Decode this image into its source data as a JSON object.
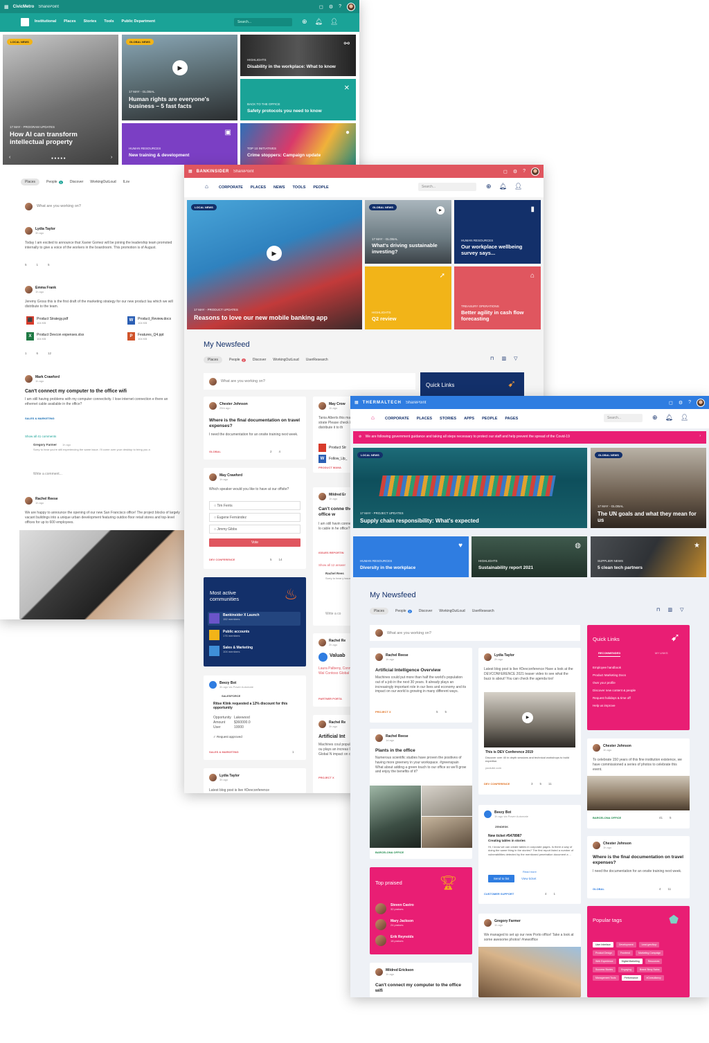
{
  "civic": {
    "brand": "CivicMetro",
    "app": "SharePoint",
    "nav": [
      "Institutional",
      "Places",
      "Stories",
      "Tools",
      "Public Department"
    ],
    "search_placeholder": "Search...",
    "tiles": [
      {
        "badge": "LOCAL NEWS",
        "meta": "17 MAY - PROGRAM UPDATES",
        "title": "How AI can transform intellectual property"
      },
      {
        "badge": "GLOBAL NEWS",
        "meta": "17 MAY - GLOBAL",
        "title": "Human rights are everyone's business – 5 fast facts"
      },
      {
        "meta": "HIGHLIGHTS",
        "title": "Disability in the workplace: What to know"
      },
      {
        "meta": "BACK TO THE OFFICE",
        "title": "Safety protocols you need to know"
      },
      {
        "meta": "HUMAN RESOURCES",
        "title": "New training & development"
      },
      {
        "meta": "TOP 10 INITIATIVES",
        "title": "Crime stoppers: Campaign update"
      }
    ],
    "filters": [
      "Places",
      "People",
      "Discover",
      "WorkingOutLoud",
      "ILov"
    ],
    "people_count": "3",
    "compose": "What are you working on?",
    "posts": [
      {
        "name": "Lydia Taylor",
        "time": "3h ago",
        "body": "Today I am excited to announce that Xavier Gomez will be joining the leadership team promoted internally to give a voice of the workers in the boardroom. This promotion is of August.",
        "stats": [
          "5",
          "1",
          "5"
        ]
      },
      {
        "name": "Emma Frank",
        "time": "1h ago",
        "body": "Jeremy Gross this is the first draft of the marketing strategy for our new product lau which we will distribute to the team.",
        "files": [
          {
            "name": "Product Strategy.pdf",
            "size": "104 KB",
            "type": "pdf"
          },
          {
            "name": "Product_Review.docx",
            "size": "104 KB",
            "type": "docx"
          },
          {
            "name": "Product Devcon expenses.xlsx",
            "size": "104 KB",
            "type": "xlsx"
          },
          {
            "name": "Features_Q4.ppt",
            "size": "104 KB",
            "type": "ppt"
          }
        ],
        "stats": [
          "1",
          "6",
          "12"
        ]
      },
      {
        "name": "Mark Crawford",
        "time": "1h ago",
        "title": "Can't connect my computer to the office wifi",
        "body": "I am still having problems with my computer connectivity. I lose internet connection e there an ethernet cable available in the office?",
        "tag": "SALES & MARKETING",
        "show_all": "Show all 41 comments",
        "reply_name": "Gregory Farmer",
        "reply_time": "1h ago",
        "reply_body": "Sorry to hear you're still experiencing the same issue. I'll come over your desktop to bring you a",
        "comment_placeholder": "Write a comment..."
      },
      {
        "name": "Rachel Reese",
        "time": "1h ago",
        "body": "We are happy to announce the opening of our new San Francisco office! The project blocks of largely vacant buildings into a unique urban development featuring outdoo floor retail stores and top-level offices for up to 600 employees."
      }
    ]
  },
  "bank": {
    "brand": "BANKINSIDER",
    "app": "SharePoint",
    "nav": [
      "CORPORATE",
      "PLACES",
      "NEWS",
      "TOOLS",
      "PEOPLE"
    ],
    "search_placeholder": "Search...",
    "tiles": [
      {
        "badge": "LOCAL NEWS",
        "meta": "17 MAY - PRODUCT UPDATES",
        "title": "Reasons to love our new mobile banking app"
      },
      {
        "badge": "GLOBAL NEWS",
        "meta": "17 MAY - GLOBAL",
        "title": "What's driving sustainable investing?"
      },
      {
        "meta": "HUMAN RESOURCES",
        "title": "Our workplace wellbeing survey says..."
      },
      {
        "meta": "HIGHLIGHTS",
        "title": "Q2 review"
      },
      {
        "meta": "TREASURY OPERATIONS",
        "title": "Better agility in cash flow forecasting"
      }
    ],
    "newsfeed_title": "My Newsfeed",
    "filters": [
      "Places",
      "People",
      "Discover",
      "WorkingOutLoud",
      "UserResearch"
    ],
    "people_count": "2",
    "compose": "What are you working on?",
    "quick_links": "Quick Links",
    "cards": {
      "chester": {
        "name": "Chester Johnson",
        "time": "25m ago",
        "title": "Where is the final documentation on travel expenses?",
        "body": "I need the documentation for an onsite training next week.",
        "tag": "GLOBAL",
        "stats": [
          "2",
          "4"
        ]
      },
      "may_poll": {
        "name": "May Crawford",
        "time": "1h ago",
        "question": "Which speaker would you like to have at our offsite?",
        "options": [
          "Tim Ferris",
          "Eugene Fernández",
          "Jimmy Gibbs"
        ],
        "vote": "Vote",
        "tag": "DEV CONFERENCE",
        "stats": [
          "5",
          "14"
        ]
      },
      "communities": {
        "title": "Most active communities",
        "items": [
          {
            "name": "Bankinsider X Launch",
            "members": "152 members"
          },
          {
            "name": "Public accounts",
            "members": "176 members"
          },
          {
            "name": "Sales & Marketing",
            "members": "104 members"
          }
        ]
      },
      "beezy": {
        "name": "Beezy Bot",
        "time": "3h ago via Power Automate",
        "source": "SALESFORCE",
        "request": "Ritse Klink requested a 12% discount for this opportunity",
        "fields": [
          {
            "k": "Opportunity",
            "v": "Lakewood"
          },
          {
            "k": "Amount",
            "v": "$360000.0"
          },
          {
            "k": "User",
            "v": "10000"
          }
        ],
        "approved": "Request approved",
        "tag": "SALES & MARKETING",
        "stats": [
          "1"
        ]
      },
      "lydia": {
        "name": "Lydia Taylor",
        "time": "3h ago",
        "body": "Latest blog post is live #Devconference"
      },
      "may_files": {
        "name": "May Crow",
        "time": "1h ago",
        "body": "Tania Alberts this marketing strate Please check it o distribute it to th",
        "files": [
          "Product Str",
          "Follow_Up_"
        ],
        "tag": "PRODUCT MANA"
      },
      "mildred": {
        "name": "Mildred Er",
        "time": "1h ago",
        "title": "Can't conne the office w",
        "body": "I am still havin connectivity. I lo cable in he office?",
        "tag": "ISSUES REPORTIN",
        "show_all": "Show all 12 answer",
        "reply_name": "Rachel Rees",
        "reply_body": "Sorry to hear y issue. I'll com",
        "comment_placeholder": "Write a co"
      },
      "rachel1": {
        "name": "Rachel Re",
        "time": "2h ago",
        "title": "Valuab",
        "body": "Laura Palbeny, Conner, Jim Wal Contoso Global N",
        "tag": "PARTNER PORTA"
      },
      "rachel2": {
        "name": "Rachel Re",
        "time": "3h ago",
        "title": "Artificial Int",
        "body": "Machines coul population of ou plays an increas Contoso Global N impact on our",
        "tag": "PROJECT X"
      }
    }
  },
  "thermal": {
    "brand": "THERMALTECH",
    "app": "SharePoint",
    "nav": [
      "CORPORATE",
      "PLACES",
      "STORIES",
      "APPS",
      "PEOPLE",
      "PAGES"
    ],
    "search_placeholder": "Search...",
    "alert": "We are following government guidance and taking all steps necessary to protect our staff and help prevent the spread of the Covid-19",
    "tiles": [
      {
        "badge": "LOCAL NEWS",
        "meta": "17 MAY - PROJECT UPDATES",
        "title": "Supply chain responsibility: What's expected"
      },
      {
        "badge": "GLOBAL NEWS",
        "meta": "17 MAY - GLOBAL",
        "title": "The UN goals and what they mean for us"
      },
      {
        "meta": "HUMAN RESOURCES",
        "title": "Diversity in the workplace"
      },
      {
        "meta": "HIGHLIGHTS",
        "title": "Sustainability report 2021"
      },
      {
        "meta": "SUPPLIER NEWS",
        "title": "5 clean tech partners"
      }
    ],
    "newsfeed_title": "My Newsfeed",
    "filters": [
      "Places",
      "People",
      "Discover",
      "WorkingOutLoud",
      "UserResearch"
    ],
    "people_count": "2",
    "compose": "What are you working on?",
    "quick_links": {
      "title": "Quick Links",
      "tabs": [
        "RECOMMENDED",
        "MY LINKS"
      ],
      "items": [
        "Employee handbook",
        "Product Marketing Docs",
        "Own your profile",
        "Discover new content & people",
        "Request holidays & time off",
        "Help us improve"
      ]
    },
    "cards": {
      "rachel_ai": {
        "name": "Rachel Reese",
        "time": "1h ago",
        "title": "Artificial Intelligence Overview",
        "body": "Machines could put more than half the world's population out of a job in the next 30 years. It already plays an increasingly important role in our lives and economy and its impact on our world is growing in many different ways.",
        "tag": "PROJECT X",
        "stats": [
          "5",
          "5"
        ]
      },
      "lydia": {
        "name": "Lydia Taylor",
        "time": "2h ago",
        "body": "Latest blog post is live #Devconference Have a look at the DEVCONFERENCE 2021 teaser video to see what the buzz is about! You can check the agenda too!",
        "video_title": "This is DEV Conference 2019",
        "video_desc": "Discover over 40 in depth sessions and technical workshops to build expertise.",
        "video_src": "youtube.com",
        "tag": "DEV CONFERENCE",
        "stats": [
          "3",
          "5",
          "11"
        ]
      },
      "rachel_plants": {
        "name": "Rachel Reese",
        "time": "1d ago",
        "title": "Plants in the office",
        "body": "Numerous scientific studies have proven the positives of having more greenery in your workspace. #greenspain What about adding a green touch to our office so we'll grow and enjoy the benefits of it?",
        "tag": "BARCELONA OFFICE"
      },
      "beezy": {
        "name": "Beezy Bot",
        "time": "1h ago via Power Automate",
        "source": "ZENDESK",
        "ticket": "New ticket #5478987",
        "ticket_title": "Creating tables in stories",
        "body": "Hi, I know we can create tables in corporate pages. Is there a way of doing the same thing in the stories? The first report listed a number of vulnerabilities detected by the mentioned penetration document a ...",
        "read_more": "Read more",
        "send": "Send to list",
        "view": "View ticket",
        "tag": "CUSTOMER SUPPORT",
        "stats": [
          "4",
          "1"
        ]
      },
      "top_praised": {
        "title": "Top praised",
        "items": [
          {
            "name": "Steven Castro",
            "count": "32 praises"
          },
          {
            "name": "Mary Jackson",
            "count": "24 praises"
          },
          {
            "name": "Erik Reynolds",
            "count": "18 praises"
          }
        ]
      },
      "gregory": {
        "name": "Gregory Farmer",
        "time": "1h ago",
        "body": "We managed to set up our new Porto office! Take a look at some awesome photos! #newoffice"
      },
      "mildred": {
        "name": "Mildred Erickson",
        "time": "1h ago",
        "title": "Can't connect my computer to the office wifi"
      },
      "chester_office": {
        "name": "Chester Johnson",
        "time": "1h ago",
        "body": "To celebrate 150 years of this fine institution existence, we have commissioned a series of photos to celebrate this event.",
        "tag": "BARCELONA OFFICE",
        "stats": [
          "41",
          "5"
        ]
      },
      "chester_q": {
        "name": "Chester Johnson",
        "time": "1h ago",
        "title": "Where is the final documentation on travel expenses?",
        "body": "I need the documentation for an onsite training next week.",
        "tag": "GLOBAL",
        "stats": [
          "4",
          "11"
        ]
      },
      "popular_tags": {
        "title": "Popular tags",
        "items": [
          "User Interface",
          "Development",
          "Lead genAtop",
          "Product Design",
          "Frontend",
          "Marketing Campaign",
          "Web Experience",
          "Digital Marketing",
          "Resources",
          "Success Stories",
          "Engaging",
          "Brand Stroy Swiss",
          "Management Tools",
          "Performance",
          "eConsultancy"
        ],
        "highlight": [
          "User Interface",
          "Digital Marketing",
          "Performance"
        ]
      }
    }
  },
  "colors": {
    "civic": "#1aa397",
    "bank": "#e0565f",
    "thermal": "#2f7de1",
    "pink": "#e91e74",
    "navy": "#13306a",
    "yellow": "#f2b418"
  }
}
